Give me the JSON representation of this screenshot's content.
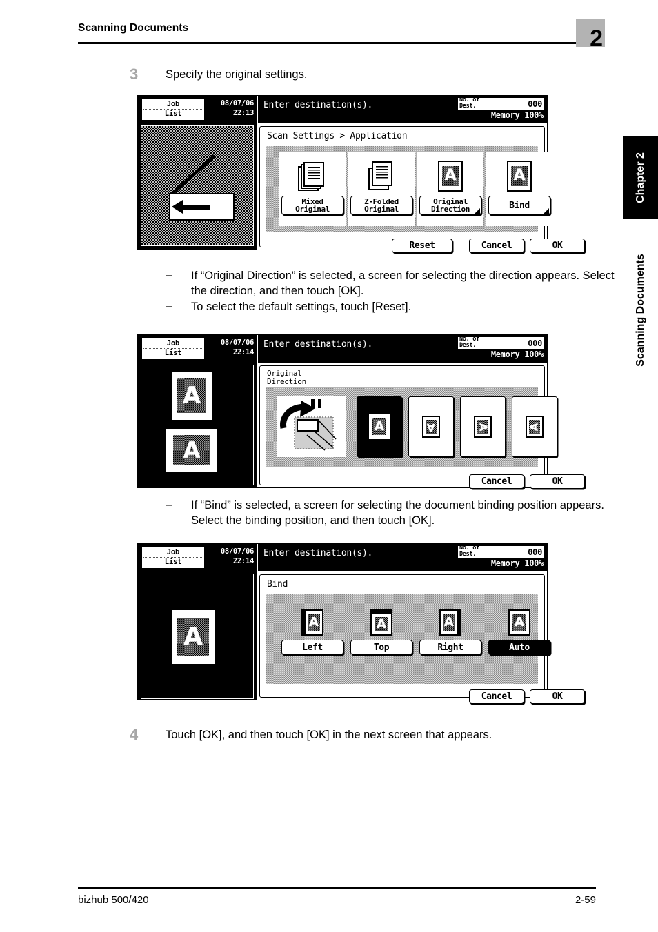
{
  "header": {
    "title": "Scanning Documents",
    "chapter_number": "2"
  },
  "side": {
    "tab_label": "Chapter 2",
    "vertical_label": "Scanning Documents"
  },
  "footer": {
    "product": "bizhub 500/420",
    "page": "2-59"
  },
  "steps": [
    {
      "number": "3",
      "text": "Specify the original settings."
    },
    {
      "number": "4",
      "text": "Touch [OK], and then touch [OK] in the next screen that appears."
    }
  ],
  "bullets_after_step3": [
    {
      "dash": "–",
      "text": "If “Original Direction” is selected, a screen for selecting the direction appears. Select the direction, and then touch [OK]."
    },
    {
      "dash": "–",
      "text": "To select the default settings, touch [Reset]."
    }
  ],
  "bullets_after_screen2": [
    {
      "dash": "–",
      "text": "If “Bind” is selected, a screen for selecting the document binding position appears. Select the binding position, and then touch [OK]."
    }
  ],
  "screens": [
    {
      "id": "application-screen",
      "topbar": {
        "job_list_line1": "Job",
        "job_list_line2": "List",
        "date": "08/07/06",
        "time": "22:13",
        "message": "Enter destination(s).",
        "dest_label_line1": "No. of",
        "dest_label_line2": "Dest.",
        "dest_value": "000",
        "memory": "Memory 100%"
      },
      "breadcrumb": "Scan Settings > Application",
      "tiles": [
        {
          "icon": "mixed-original-icon",
          "label_line1": "Mixed",
          "label_line2": "Original",
          "selected": false,
          "has_corner": false
        },
        {
          "icon": "z-folded-original-icon",
          "label_line1": "Z-Folded",
          "label_line2": "Original",
          "selected": false,
          "has_corner": false
        },
        {
          "icon": "original-direction-icon",
          "label_line1": "Original",
          "label_line2": "Direction",
          "selected": false,
          "has_corner": true
        },
        {
          "icon": "bind-icon",
          "label_line1": "Bind",
          "label_line2": "",
          "selected": false,
          "has_corner": true
        }
      ],
      "actions": [
        {
          "label": "Reset",
          "selected": false
        },
        {
          "label": "Cancel",
          "selected": false
        },
        {
          "label": "OK",
          "selected": false
        }
      ],
      "preview": "arrow-left-preview"
    },
    {
      "id": "original-direction-screen",
      "topbar": {
        "job_list_line1": "Job",
        "job_list_line2": "List",
        "date": "08/07/06",
        "time": "22:14",
        "message": "Enter destination(s).",
        "dest_label_line1": "No. of",
        "dest_label_line2": "Dest.",
        "dest_value": "000",
        "memory": "Memory 100%"
      },
      "breadcrumb_line1": "Original",
      "breadcrumb_line2": "Direction",
      "orientations": [
        {
          "name": "orientation-top-up",
          "glyph": "A",
          "rotation": 0,
          "selected": true
        },
        {
          "name": "orientation-bottom-up",
          "glyph": "A",
          "rotation": 180,
          "selected": false
        },
        {
          "name": "orientation-left",
          "glyph": "A",
          "rotation": 90,
          "selected": false
        },
        {
          "name": "orientation-right",
          "glyph": "A",
          "rotation": 270,
          "selected": false
        }
      ],
      "actions": [
        {
          "label": "Cancel",
          "selected": false
        },
        {
          "label": "OK",
          "selected": false
        }
      ],
      "preview": "two-sheets-preview"
    },
    {
      "id": "bind-screen",
      "topbar": {
        "job_list_line1": "Job",
        "job_list_line2": "List",
        "date": "08/07/06",
        "time": "22:14",
        "message": "Enter destination(s).",
        "dest_label_line1": "No. of",
        "dest_label_line2": "Dest.",
        "dest_value": "000",
        "memory": "Memory 100%"
      },
      "breadcrumb": "Bind",
      "bind_options": [
        {
          "label": "Left",
          "edge": "left",
          "selected": false
        },
        {
          "label": "Top",
          "edge": "top",
          "selected": false
        },
        {
          "label": "Right",
          "edge": "right",
          "selected": false
        },
        {
          "label": "Auto",
          "edge": "none",
          "selected": true
        }
      ],
      "actions": [
        {
          "label": "Cancel",
          "selected": false
        },
        {
          "label": "OK",
          "selected": false
        }
      ],
      "preview": "single-sheet-preview"
    }
  ],
  "colors": {
    "chapter_badge": "#b3b3b3",
    "step_number": "#a6a6a6",
    "ink": "#000000",
    "paper": "#ffffff"
  }
}
